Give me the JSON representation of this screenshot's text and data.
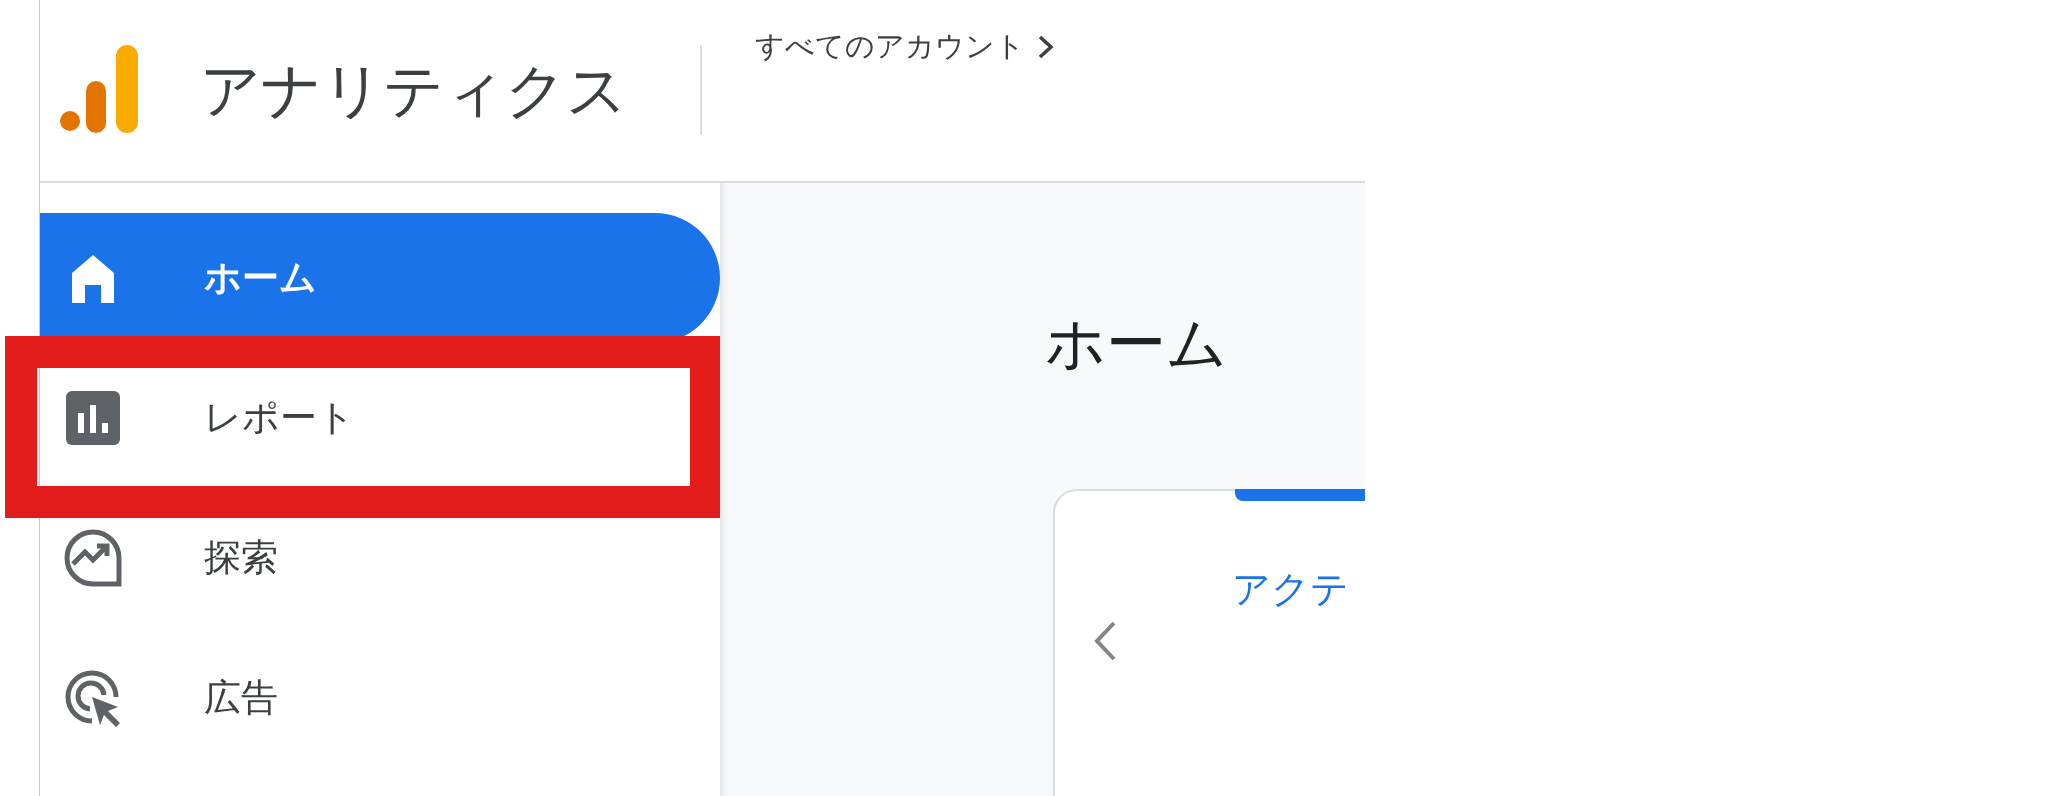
{
  "header": {
    "product_name": "アナリティクス",
    "account_link": "すべてのアカウント"
  },
  "sidebar": {
    "items": [
      {
        "kind": "home",
        "label": "ホーム",
        "selected": true,
        "highlighted": false
      },
      {
        "kind": "reports",
        "label": "レポート",
        "selected": false,
        "highlighted": true
      },
      {
        "kind": "explore",
        "label": "探索",
        "selected": false,
        "highlighted": false
      },
      {
        "kind": "advertising",
        "label": "広告",
        "selected": false,
        "highlighted": false
      }
    ]
  },
  "main": {
    "title": "ホーム",
    "card": {
      "tab_label": "アクテ"
    }
  }
}
